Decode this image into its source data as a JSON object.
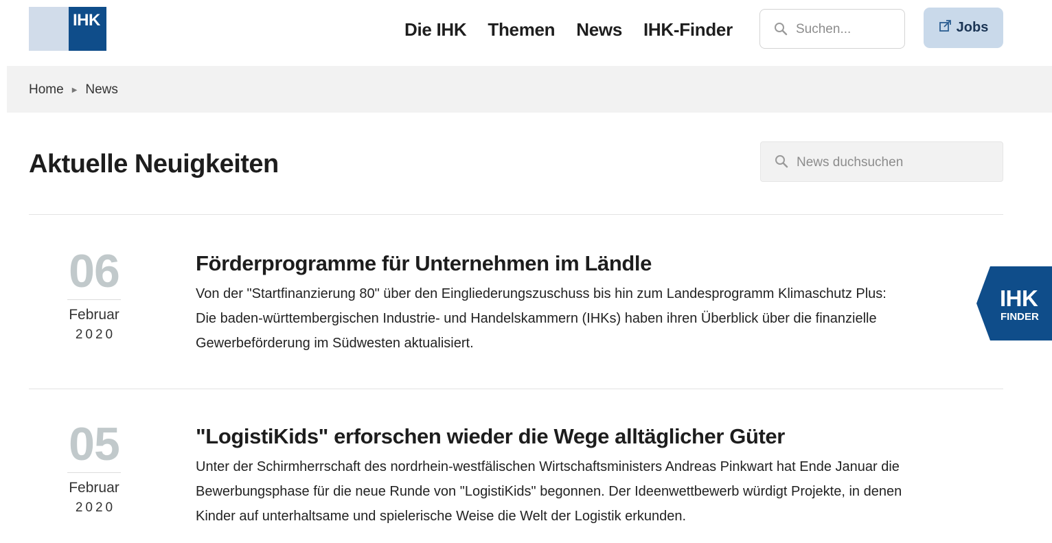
{
  "header": {
    "logo_text": "IHK",
    "nav": [
      "Die IHK",
      "Themen",
      "News",
      "IHK-Finder"
    ],
    "search_placeholder": "Suchen...",
    "jobs_label": "Jobs",
    "colors": {
      "logo_dark": "#0f4d8a",
      "logo_light": "#d1dcea",
      "jobs_bg": "#c9d9ea"
    }
  },
  "breadcrumb": {
    "items": [
      "Home",
      "News"
    ]
  },
  "page": {
    "title": "Aktuelle Neuigkeiten",
    "news_search_placeholder": "News duchsuchen"
  },
  "news": [
    {
      "day": "06",
      "month": "Februar",
      "year": "2020",
      "title": "Förderprogramme für Unternehmen im Ländle",
      "text": "Von der \"Startfinanzierung 80\" über den Eingliederungszuschuss bis hin zum Landesprogramm Klimaschutz Plus: Die baden-württembergischen Industrie- und Handelskammern (IHKs) haben ihren Überblick über die finanzielle Gewerbeförderung im Südwesten aktualisiert."
    },
    {
      "day": "05",
      "month": "Februar",
      "year": "2020",
      "title": "\"LogistiKids\" erforschen wieder die Wege alltäglicher Güter",
      "text": "Unter der Schirmherrschaft des nordrhein-westfälischen Wirtschaftsministers Andreas Pinkwart hat Ende Januar die Bewerbungsphase für die neue Runde von \"LogistiKids\" begonnen. Der Ideenwettbewerb würdigt Projekte, in denen Kinder auf unterhaltsame und spielerische Weise die Welt der Logistik erkunden."
    }
  ],
  "finder_badge": {
    "line1": "IHK",
    "line2": "FINDER",
    "color": "#0f4d8a"
  },
  "icons": {
    "search": "search-icon",
    "external": "external-link-icon"
  }
}
